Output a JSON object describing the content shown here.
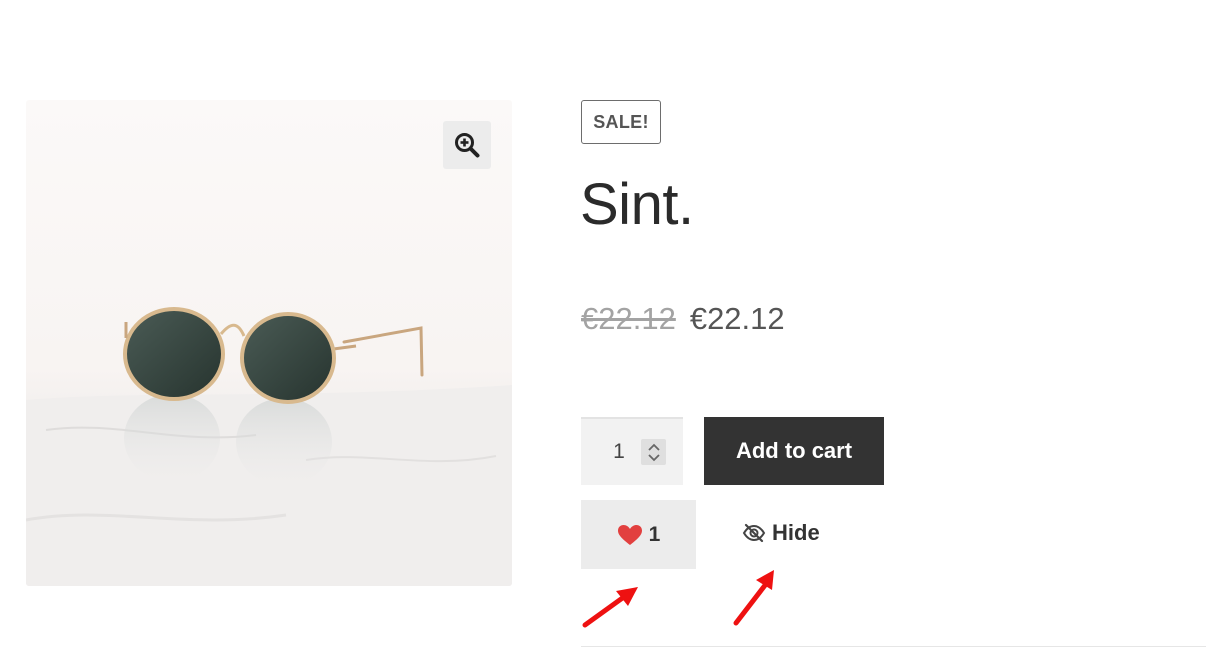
{
  "product": {
    "sale_badge": "SALE!",
    "title": "Sint.",
    "price_regular": "€22.12",
    "price_sale": "€22.12",
    "image_alt": "Round gold-frame sunglasses with dark green lenses"
  },
  "cart_form": {
    "quantity": "1",
    "add_to_cart_label": "Add to cart"
  },
  "actions": {
    "like_count": "1",
    "hide_label": "Hide"
  },
  "icons": {
    "zoom": "zoom-in-icon",
    "like": "heart-icon",
    "hide": "eye-slash-icon",
    "annotation": "red-arrow-icon"
  },
  "colors": {
    "button_dark": "#333333",
    "heart": "#e2403f",
    "annotation_arrow": "#ee1111",
    "badge_border": "#6d6d6d"
  }
}
